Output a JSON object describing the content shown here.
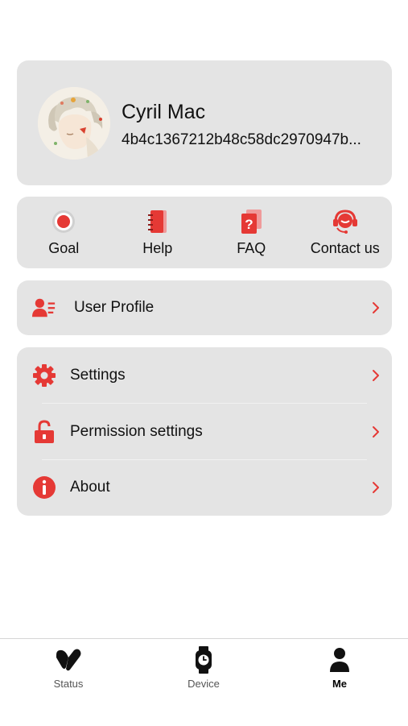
{
  "profile": {
    "name": "Cyril Mac",
    "user_id": "4b4c1367212b48c58dc2970947b..."
  },
  "quick_actions": [
    {
      "label": "Goal",
      "icon": "goal-icon"
    },
    {
      "label": "Help",
      "icon": "help-book-icon"
    },
    {
      "label": "FAQ",
      "icon": "faq-icon"
    },
    {
      "label": "Contact us",
      "icon": "headset-icon"
    }
  ],
  "menu_primary": [
    {
      "label": "User Profile",
      "icon": "user-profile-icon"
    }
  ],
  "menu_secondary": [
    {
      "label": "Settings",
      "icon": "gear-icon"
    },
    {
      "label": "Permission settings",
      "icon": "lock-icon"
    },
    {
      "label": "About",
      "icon": "info-icon"
    }
  ],
  "tabbar": {
    "tabs": [
      {
        "label": "Status",
        "icon": "status-icon",
        "active": false
      },
      {
        "label": "Device",
        "icon": "watch-icon",
        "active": false
      },
      {
        "label": "Me",
        "icon": "person-icon",
        "active": true
      }
    ]
  },
  "colors": {
    "accent": "#e53935",
    "card_bg": "#e4e4e4",
    "tab_active": "#000000",
    "tab_inactive": "#555555"
  }
}
